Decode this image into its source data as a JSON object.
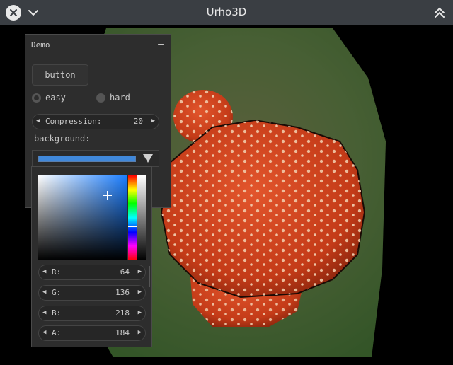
{
  "window": {
    "title": "Urho3D"
  },
  "demo": {
    "title": "Demo",
    "minimize": "–",
    "button_label": "button",
    "radio_easy": "easy",
    "radio_hard": "hard",
    "compression_label": "Compression:",
    "compression_value": "20",
    "background_label": "background:",
    "background_color": "#4088da"
  },
  "picker": {
    "r_label": "R:",
    "r_value": "64",
    "g_label": "G:",
    "g_value": "136",
    "b_label": "B:",
    "b_value": "218",
    "a_label": "A:",
    "a_value": "184"
  },
  "icons": {
    "close": "close-icon",
    "chevron": "chevron-down-icon",
    "keep_above": "double-chevron-up-icon"
  },
  "colors": {
    "titlebar": "#3a3e43",
    "accent": "#2b8bd1",
    "panel": "#2d2d2d"
  }
}
